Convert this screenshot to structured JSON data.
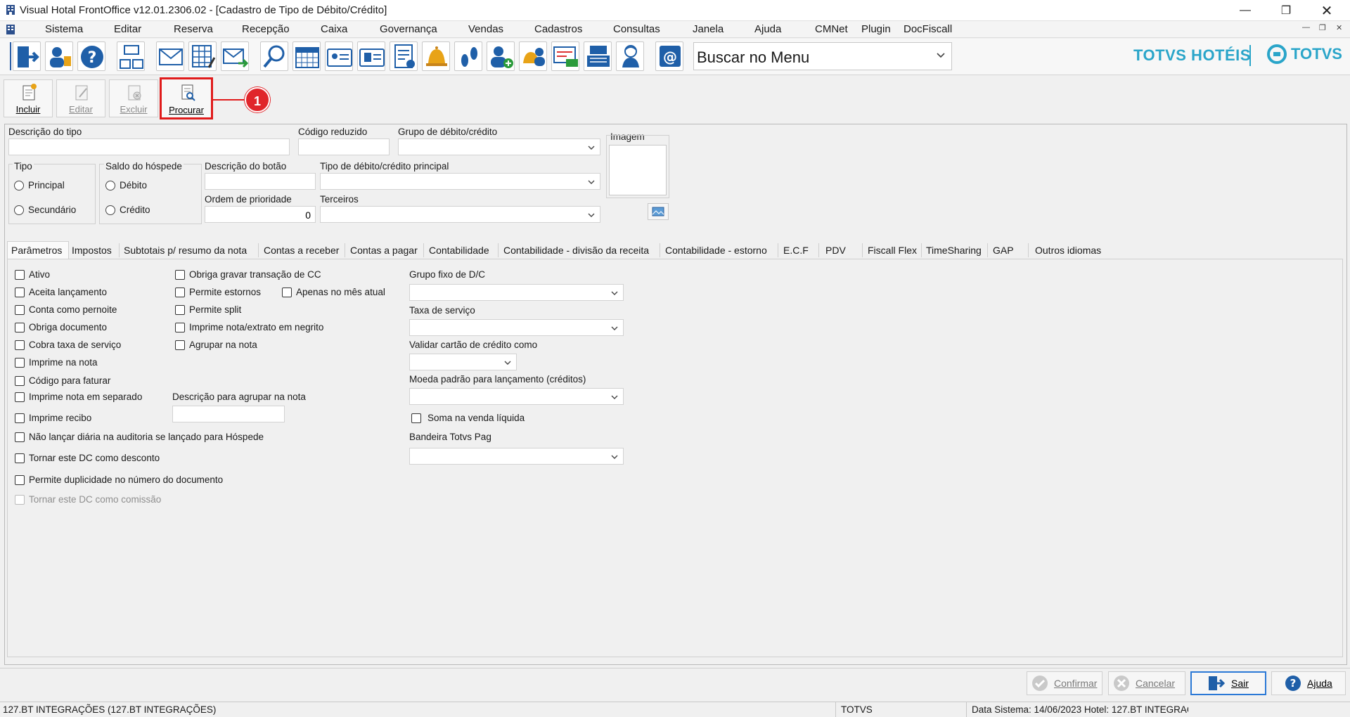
{
  "window": {
    "title": "Visual Hotal FrontOffice v12.01.2306.02 - [Cadastro de Tipo de Débito/Crédito]"
  },
  "menu": [
    "Sistema",
    "Editar",
    "Reserva",
    "Recepção",
    "Caixa",
    "Governança",
    "Vendas",
    "Cadastros",
    "Consultas",
    "Janela",
    "Ajuda",
    "CMNet",
    "Plugin",
    "DocFiscall"
  ],
  "toolbar": {
    "icons": [
      "exit-icon",
      "users-icon",
      "help-icon",
      "layout-icon",
      "mail-icon",
      "grid-edit-icon",
      "mail-send-icon",
      "search-icon",
      "calendar-icon",
      "card-icon",
      "card-photo-icon",
      "report-icon",
      "bell-icon",
      "footprints-icon",
      "add-user-icon",
      "user-bell-icon",
      "money-screen-icon",
      "cash-register-icon",
      "receptionist-icon",
      "at-mail-icon"
    ],
    "search_value": "Buscar no Menu"
  },
  "brand": {
    "hotels": "TOTVS HOTÉIS",
    "totvs": "TOTVS"
  },
  "actions": {
    "incluir": "Incluir",
    "editar": "Editar",
    "excluir": "Excluir",
    "procurar": "Procurar"
  },
  "callout": "1",
  "form": {
    "descricao_tipo": "Descrição do tipo",
    "codigo_reduzido": "Código reduzido",
    "grupo_debito_credito": "Grupo de débito/crédito",
    "imagem": "Imagem",
    "tipo": "Tipo",
    "tipo_principal": "Principal",
    "tipo_secundario": "Secundário",
    "saldo_hospede": "Saldo do hóspede",
    "saldo_debito": "Débito",
    "saldo_credito": "Crédito",
    "descricao_botao": "Descrição do botão",
    "tipo_principal_dc": "Tipo de débito/crédito principal",
    "ordem_prioridade": "Ordem de prioridade",
    "ordem_prioridade_value": "0",
    "terceiros": "Terceiros"
  },
  "tabs": [
    "Parâmetros",
    "Impostos",
    "Subtotais p/ resumo da nota",
    "Contas a receber",
    "Contas a pagar",
    "Contabilidade",
    "Contabilidade - divisão da receita",
    "Contabilidade - estorno",
    "E.C.F",
    "PDV",
    "Fiscall Flex",
    "TimeSharing",
    "GAP",
    "Outros idiomas"
  ],
  "params": {
    "col1": [
      "Ativo",
      "Aceita lançamento",
      "Conta como pernoite",
      "Obriga documento",
      "Cobra taxa de serviço",
      "Imprime na nota",
      "Código para faturar",
      "Imprime nota em separado",
      "Imprime recibo",
      "Não lançar diária na auditoria se lançado para Hóspede",
      "Tornar este DC como desconto",
      "Permite duplicidade no número do documento",
      "Tornar este DC como comissão"
    ],
    "col2": [
      "Obriga gravar transação de CC",
      "Permite estornos",
      "Permite split",
      "Imprime nota/extrato em negrito",
      "Agrupar na nota"
    ],
    "apenas_mes_atual": "Apenas no mês atual",
    "descricao_agrupar": "Descrição para agrupar na nota",
    "grupo_fixo": "Grupo fixo de D/C",
    "taxa_servico": "Taxa de serviço",
    "validar_cartao": "Validar cartão de crédito como",
    "moeda_padrao": "Moeda padrão para lançamento (créditos)",
    "soma_venda": "Soma na venda líquida",
    "bandeira": "Bandeira Totvs Pag"
  },
  "bottom": {
    "confirmar": "Confirmar",
    "cancelar": "Cancelar",
    "sair": "Sair",
    "ajuda": "Ajuda"
  },
  "status": {
    "user": "127.BT INTEGRAÇÕES (127.BT INTEGRAÇÕES)",
    "company": "TOTVS",
    "info": "Data Sistema: 14/06/2023  Hotel: 127.BT INTEGRAÇ"
  }
}
